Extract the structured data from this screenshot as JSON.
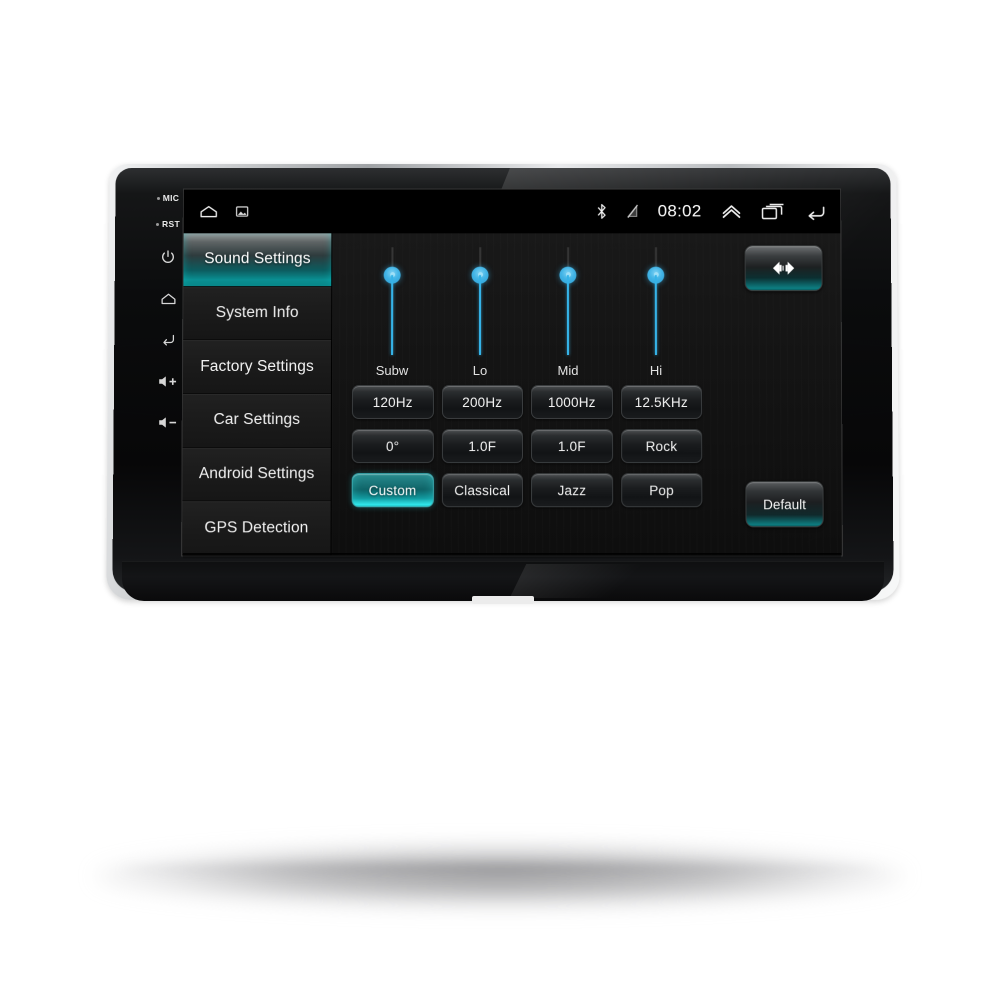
{
  "device": {
    "name": "android-car-head-unit",
    "hardware_buttons": [
      {
        "label": "MIC",
        "icon": "microphone-indicator"
      },
      {
        "label": "RST",
        "icon": "reset-pinhole"
      },
      {
        "label": "",
        "icon": "power-icon"
      },
      {
        "label": "",
        "icon": "home-icon"
      },
      {
        "label": "",
        "icon": "back-icon"
      },
      {
        "label": "",
        "icon": "volume-up-icon"
      },
      {
        "label": "",
        "icon": "volume-down-icon"
      }
    ]
  },
  "statusbar": {
    "left_icons": [
      {
        "name": "home-icon"
      },
      {
        "name": "screenshot-icon"
      }
    ],
    "bluetooth_icon": "bluetooth-icon",
    "signal_icon": "no-signal-icon",
    "clock": "08:02",
    "right_icons": [
      {
        "name": "chevron-up-icon"
      },
      {
        "name": "recents-icon"
      },
      {
        "name": "back-icon"
      }
    ]
  },
  "sidebar": {
    "items": [
      {
        "label": "Sound Settings",
        "active": true
      },
      {
        "label": "System Info",
        "active": false
      },
      {
        "label": "Factory Settings",
        "active": false
      },
      {
        "label": "Car Settings",
        "active": false
      },
      {
        "label": "Android Settings",
        "active": false
      },
      {
        "label": "GPS Detection",
        "active": false
      }
    ]
  },
  "panel": {
    "title": "Sound Settings",
    "balance_button": {
      "name": "balance-fader-button",
      "icon": "speaker-balance-icon"
    },
    "faders": [
      {
        "label": "Subw",
        "percent": 72
      },
      {
        "label": "Lo",
        "percent": 72
      },
      {
        "label": "Mid",
        "percent": 72
      },
      {
        "label": "Hi",
        "percent": 72
      }
    ],
    "buttons": [
      {
        "label": "120Hz",
        "selected": false
      },
      {
        "label": "200Hz",
        "selected": false
      },
      {
        "label": "1000Hz",
        "selected": false
      },
      {
        "label": "12.5KHz",
        "selected": false
      },
      {
        "label": "0°",
        "selected": false
      },
      {
        "label": "1.0F",
        "selected": false
      },
      {
        "label": "1.0F",
        "selected": false
      },
      {
        "label": "Rock",
        "selected": false
      },
      {
        "label": "Custom",
        "selected": true
      },
      {
        "label": "Classical",
        "selected": false
      },
      {
        "label": "Jazz",
        "selected": false
      },
      {
        "label": "Pop",
        "selected": false
      }
    ],
    "default_button": "Default"
  },
  "colors": {
    "accent_cyan": "#12a3a8",
    "slider_blue": "#35b3e8",
    "screen_bg": "#0e0e0e",
    "sidebar_bg": "#1a1a1a",
    "page_bg": "#ffffff"
  }
}
